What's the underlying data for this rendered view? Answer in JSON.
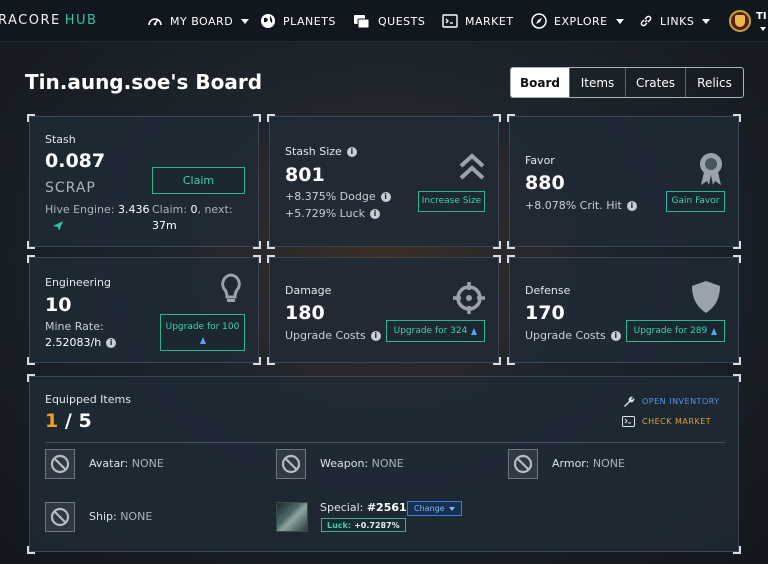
{
  "nav": {
    "logo_main": "RACORE",
    "logo_accent": "HUB",
    "items": [
      {
        "label": "MY BOARD",
        "icon": "gauge-icon",
        "dropdown": true
      },
      {
        "label": "PLANETS",
        "icon": "globe-icon",
        "dropdown": false
      },
      {
        "label": "QUESTS",
        "icon": "scroll-icon",
        "dropdown": false
      },
      {
        "label": "MARKET",
        "icon": "terminal-icon",
        "dropdown": false
      },
      {
        "label": "EXPLORE",
        "icon": "compass-icon",
        "dropdown": true
      },
      {
        "label": "LINKS",
        "icon": "link-icon",
        "dropdown": true
      }
    ],
    "user_initials": "TI"
  },
  "page": {
    "title": "Tin.aung.soe's Board",
    "tabs": [
      {
        "label": "Board",
        "active": true
      },
      {
        "label": "Items",
        "active": false
      },
      {
        "label": "Crates",
        "active": false
      },
      {
        "label": "Relics",
        "active": false
      }
    ]
  },
  "stash": {
    "label": "Stash",
    "value": "0.087",
    "unit": "SCRAP",
    "hive_label": "Hive Engine:",
    "hive_value": "3.436",
    "claim_label": "Claim:",
    "claim_value": "0",
    "next_label": ", next:",
    "next_value": "37m",
    "claim_button": "Claim"
  },
  "stash_size": {
    "label": "Stash Size",
    "value": "801",
    "dodge": "+8.375% Dodge",
    "luck": "+5.729% Luck",
    "button": "Increase Size"
  },
  "favor": {
    "label": "Favor",
    "value": "880",
    "crit": "+8.078% Crit. Hit",
    "button": "Gain Favor"
  },
  "engineering": {
    "label": "Engineering",
    "value": "10",
    "rate_label": "Mine Rate:",
    "rate_value": "2.52083/h",
    "button": "Upgrade for 100"
  },
  "damage": {
    "label": "Damage",
    "value": "180",
    "costs_label": "Upgrade Costs",
    "button": "Upgrade for 324"
  },
  "defense": {
    "label": "Defense",
    "value": "170",
    "costs_label": "Upgrade Costs",
    "button": "Upgrade for 289"
  },
  "equipped": {
    "label": "Equipped Items",
    "count": "1",
    "separator": "/",
    "max": "5",
    "open_inventory": "OPEN INVENTORY",
    "check_market": "CHECK MARKET",
    "slots": {
      "avatar": {
        "label": "Avatar:",
        "value": "NONE"
      },
      "weapon": {
        "label": "Weapon:",
        "value": "NONE"
      },
      "armor": {
        "label": "Armor:",
        "value": "NONE"
      },
      "ship": {
        "label": "Ship:",
        "value": "NONE"
      },
      "special": {
        "label": "Special:",
        "value": "#2561",
        "change": "Change",
        "luck_label": "Luck:",
        "luck_value": "+0.7287%"
      }
    }
  },
  "colors": {
    "accent_teal": "#2ec4a5",
    "count_orange": "#f0a020",
    "link_blue": "#4a9ae8",
    "link_orange": "#e0a030"
  }
}
